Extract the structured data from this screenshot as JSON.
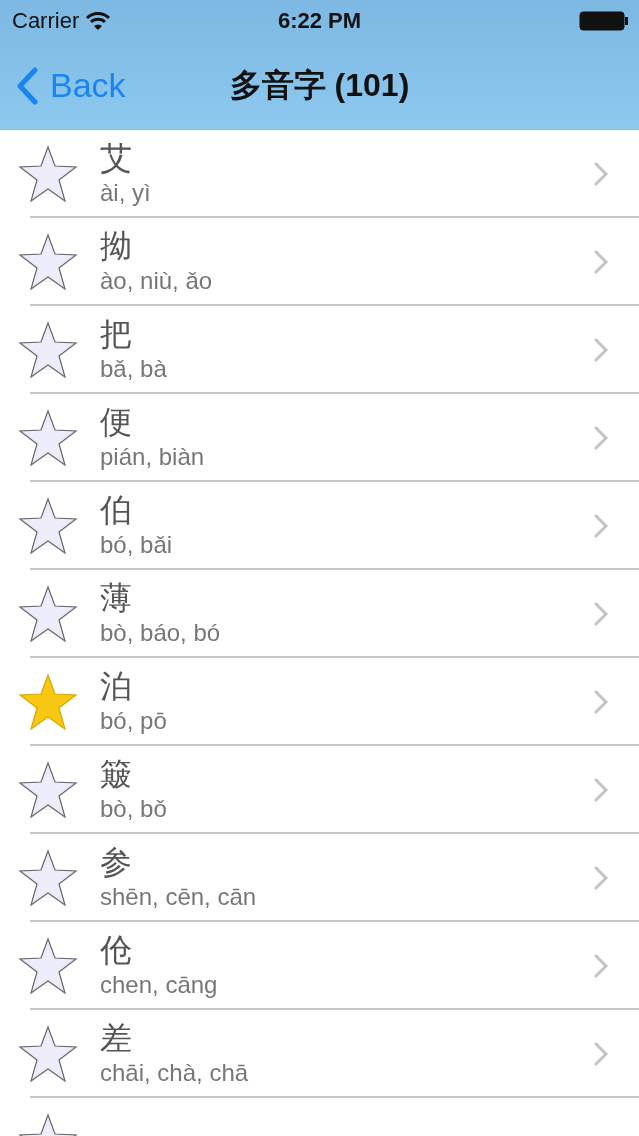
{
  "status_bar": {
    "carrier": "Carrier",
    "time": "6:22 PM"
  },
  "nav": {
    "back": "Back",
    "title": "多音字 (101)"
  },
  "rows": [
    {
      "char": "艾",
      "pinyin": "ài, yì",
      "starred": false
    },
    {
      "char": "拗",
      "pinyin": "ào, niù, ǎo",
      "starred": false
    },
    {
      "char": "把",
      "pinyin": "bǎ, bà",
      "starred": false
    },
    {
      "char": "便",
      "pinyin": "pián, biàn",
      "starred": false
    },
    {
      "char": "伯",
      "pinyin": "bó, bǎi",
      "starred": false
    },
    {
      "char": "薄",
      "pinyin": "bò, báo, bó",
      "starred": false
    },
    {
      "char": "泊",
      "pinyin": "bó, pō",
      "starred": true
    },
    {
      "char": "簸",
      "pinyin": "bò, bǒ",
      "starred": false
    },
    {
      "char": "参",
      "pinyin": "shēn, cēn, cān",
      "starred": false
    },
    {
      "char": "伧",
      "pinyin": "chen, cāng",
      "starred": false
    },
    {
      "char": "差",
      "pinyin": "chāi, chà, chā",
      "starred": false
    },
    {
      "starred": false
    }
  ]
}
